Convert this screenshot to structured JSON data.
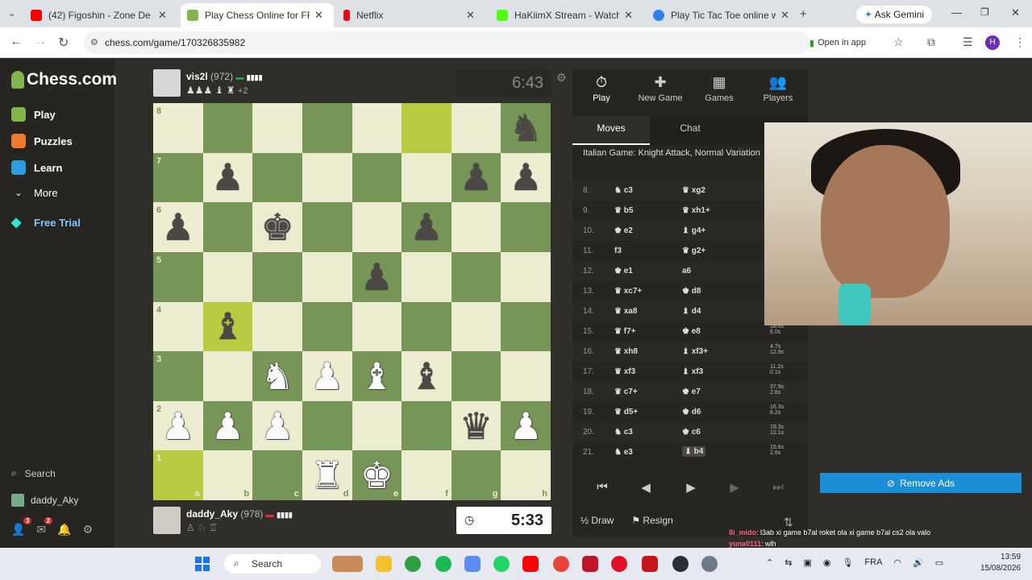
{
  "browser": {
    "tabs": [
      {
        "title": "(42) Figoshin - Zone De Conf",
        "color": "#ff0000"
      },
      {
        "title": "Play Chess Online for FREE - 2",
        "color": "#81b64c",
        "active": true
      },
      {
        "title": "Netflix",
        "color": "#e50914"
      },
      {
        "title": "HaKiimX Stream - Watch Live",
        "color": "#53fc18"
      },
      {
        "title": "Play Tic Tac Toe online with 2",
        "color": "#2f80ed"
      }
    ],
    "gemini": "Ask Gemini",
    "url": "chess.com/game/170326835982",
    "open_in_app": "Open in app",
    "profile_initial": "H"
  },
  "sidebar": {
    "logo": "Chess.com",
    "items": [
      {
        "label": "Play",
        "color": "#81b64c"
      },
      {
        "label": "Puzzles",
        "color": "#f07b2d"
      },
      {
        "label": "Learn",
        "color": "#2d9de0"
      },
      {
        "label": "More",
        "color": "#bbb"
      },
      {
        "label": "Free Trial",
        "color": "#2ee6d6"
      }
    ],
    "search": "Search",
    "username": "daddy_Aky",
    "badges": [
      "3",
      "2"
    ]
  },
  "top_player": {
    "name": "vis2l",
    "rating": "(972)",
    "captured": "♟♟♟ ♝ ♜",
    "advantage": "+2",
    "clock": "6:43"
  },
  "bottom_player": {
    "name": "daddy_Aky",
    "rating": "(978)",
    "captured": "♙ ♘ ♖",
    "clock": "5:33"
  },
  "board": {
    "rows": [
      [
        "",
        "",
        "",
        "",
        "",
        "",
        "",
        "bn"
      ],
      [
        "",
        "bp",
        "",
        "",
        "",
        "",
        "bp",
        "bp"
      ],
      [
        "bp",
        "",
        "bk",
        "",
        "",
        "bp",
        "",
        ""
      ],
      [
        "",
        "",
        "",
        "",
        "bp",
        "",
        "",
        ""
      ],
      [
        "",
        "bb",
        "",
        "",
        "",
        "",
        "",
        ""
      ],
      [
        "",
        "",
        "wn",
        "wp",
        "wb",
        "bb",
        "",
        ""
      ],
      [
        "wp",
        "wp",
        "wp",
        "",
        "",
        "",
        "bq",
        "wp"
      ],
      [
        "",
        "",
        "",
        "wr",
        "wk",
        "",
        "",
        ""
      ]
    ],
    "highlights": [
      [
        0,
        5
      ],
      [
        4,
        1
      ],
      [
        7,
        0
      ]
    ],
    "files": [
      "a",
      "b",
      "c",
      "d",
      "e",
      "f",
      "g",
      "h"
    ],
    "ranks": [
      "8",
      "7",
      "6",
      "5",
      "4",
      "3",
      "2",
      "1"
    ]
  },
  "panel": {
    "tabs": [
      {
        "label": "Play",
        "icon": "⏱"
      },
      {
        "label": "New Game",
        "icon": "✚"
      },
      {
        "label": "Games",
        "icon": "▦"
      },
      {
        "label": "Players",
        "icon": "👥"
      }
    ],
    "subtabs": [
      "Moves",
      "Chat"
    ],
    "opening": "Italian Game: Knight Attack, Normal Variation",
    "moves": [
      {
        "n": "8.",
        "w": "♞ c3",
        "b": "♛ xg2",
        "t": []
      },
      {
        "n": "9.",
        "w": "♛ b5",
        "b": "♛ xh1+",
        "t": []
      },
      {
        "n": "10.",
        "w": "♚ e2",
        "b": "♝ g4+",
        "t": []
      },
      {
        "n": "11.",
        "w": "f3",
        "b": "♛ g2+",
        "t": []
      },
      {
        "n": "12.",
        "w": "♚ e1",
        "b": "a6",
        "t": []
      },
      {
        "n": "13.",
        "w": "♛ xc7+",
        "b": "♚ d8",
        "t": []
      },
      {
        "n": "14.",
        "w": "♛ xa8",
        "b": "♝ d4",
        "t": []
      },
      {
        "n": "15.",
        "w": "♛ f7+",
        "b": "♚ e8",
        "t": [
          "18.6s",
          "6.0s"
        ]
      },
      {
        "n": "16.",
        "w": "♛ xh8",
        "b": "♝ xf3+",
        "t": [
          "4.7s",
          "12.9s"
        ]
      },
      {
        "n": "17.",
        "w": "♛ xf3",
        "b": "♝ xf3",
        "t": [
          "11.2s",
          "0.1s"
        ]
      },
      {
        "n": "18.",
        "w": "♛ c7+",
        "b": "♚ e7",
        "t": [
          "37.9s",
          "2.8s"
        ]
      },
      {
        "n": "19.",
        "w": "♛ d5+",
        "b": "♚ d6",
        "t": [
          "16.3s",
          "8.2s"
        ]
      },
      {
        "n": "20.",
        "w": "♞ c3",
        "b": "♚ c6",
        "t": [
          "19.3s",
          "12.1s"
        ]
      },
      {
        "n": "21.",
        "w": "♞ e3",
        "b": "♝ b4",
        "t": [
          "15.6s",
          "2.6s"
        ]
      }
    ],
    "draw": "½ Draw",
    "resign": "⚑ Resign"
  },
  "remove_ads": "Remove Ads",
  "stream_chat": [
    {
      "user": "8i_mido",
      "msg": ": l3ab xi game b7al roket ola xi game b7al cs2 ola valo"
    },
    {
      "user": "yuna0111",
      "msg": ": wlh"
    }
  ],
  "taskbar": {
    "search": "Search",
    "lang": "FRA",
    "time": "13:59",
    "date": "15/08/2026"
  }
}
